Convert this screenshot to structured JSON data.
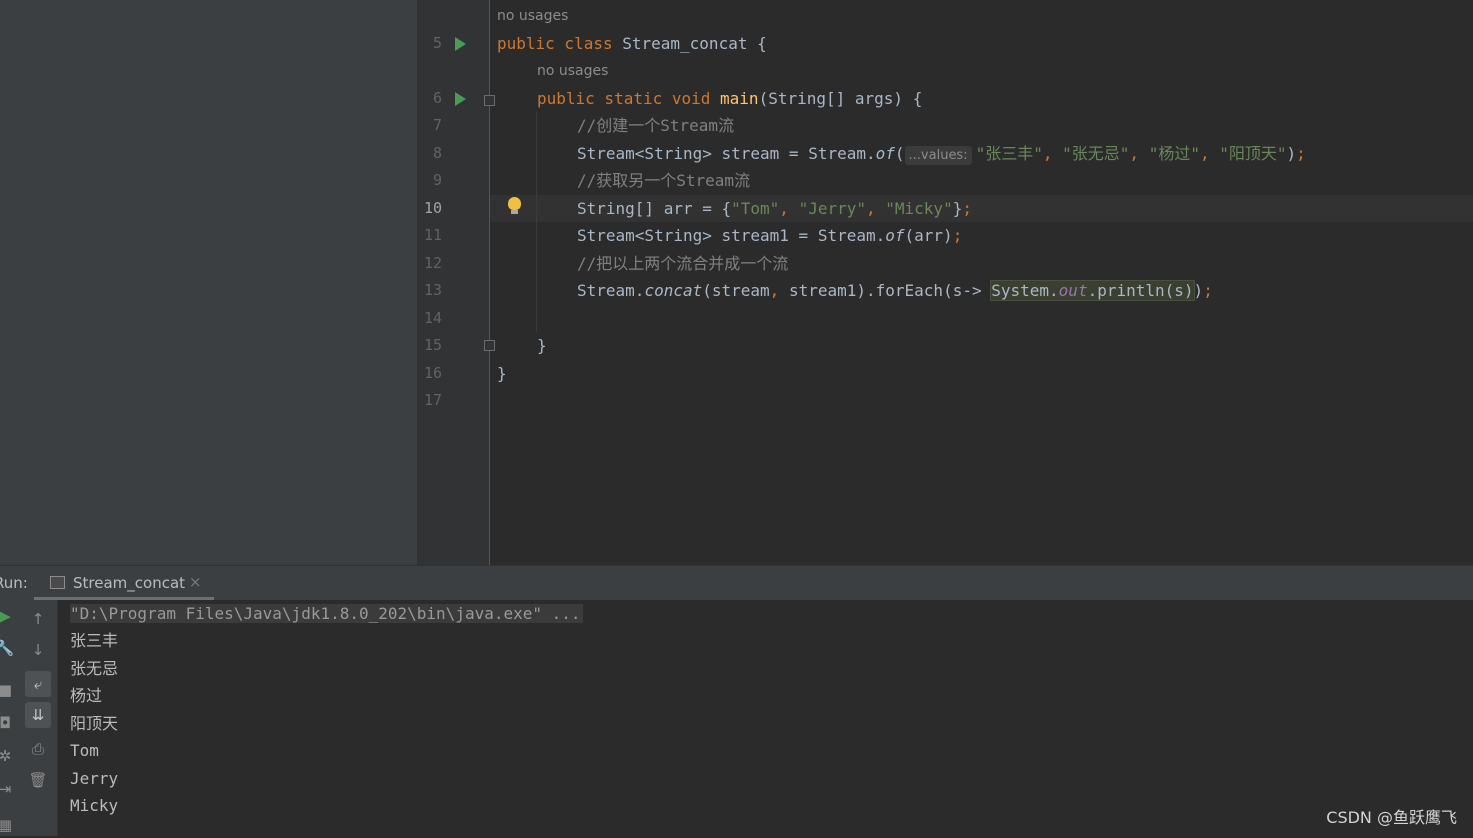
{
  "editor": {
    "hints": {
      "class_usages": "no usages",
      "main_usages": "no usages"
    },
    "line_numbers": [
      "5",
      "6",
      "7",
      "8",
      "9",
      "10",
      "11",
      "12",
      "13",
      "14",
      "15",
      "16",
      "17"
    ],
    "active_line": "10",
    "code": {
      "l5_kw": "public class ",
      "l5_name": "Stream_concat {",
      "l6_kw": "public static void ",
      "l6_fn": "main",
      "l6_rest": "(String[] args) {",
      "l7_comment": "//创建一个Stream流",
      "l8_pre": "Stream<String> stream = Stream.",
      "l8_of": "of",
      "l8_paren": "(",
      "l8_hint": "...values:",
      "l8_s1": "\"张三丰\"",
      "l8_s2": "\"张无忌\"",
      "l8_s3": "\"杨过\"",
      "l8_s4": "\"阳顶天\"",
      "l8_end": ")",
      "comma": ", ",
      "semi": ";",
      "l9_comment": "//获取另一个Stream流",
      "l10_pre": "String[] arr = {",
      "l10_s1": "\"Tom\"",
      "l10_s2": "\"Jerry\"",
      "l10_s3": "\"Micky\"",
      "l10_end": "}",
      "l11_pre": "Stream<String> stream1 = Stream.",
      "l11_of": "of",
      "l11_end": "(arr)",
      "l12_comment": "//把以上两个流合并成一个流",
      "l13_pre": "Stream.",
      "l13_concat": "concat",
      "l13_args1": "(stream",
      "l13_args2": "stream1).forEach(s-> ",
      "l13_sys": "System.",
      "l13_out": "out",
      "l13_println": ".println(s)",
      "l13_end": ")",
      "l15_brace": "}",
      "l16_brace": "}"
    }
  },
  "run_panel": {
    "label": "Run:",
    "tab_label": "Stream_concat",
    "tab_close": "×",
    "output": [
      "\"D:\\Program Files\\Java\\jdk1.8.0_202\\bin\\java.exe\" ...",
      "张三丰",
      "张无忌",
      "杨过",
      "阳顶天",
      "Tom",
      "Jerry",
      "Micky"
    ]
  },
  "toolbar": {
    "up_icon": "↑",
    "down_icon": "↓",
    "wrap_icon": "⤶",
    "scroll_end_icon": "⇊",
    "print_icon": "⎙",
    "trash_icon": "🗑",
    "rerun_icon": "▶",
    "wrench_icon": "🔧",
    "stop_icon": "■",
    "camera_icon": "◘",
    "settings_icon": "✲",
    "exit_icon": "⇥",
    "layout_icon": "▦"
  },
  "watermark": "CSDN @鱼跃鹰飞",
  "colors": {
    "keyword": "#cc7832",
    "string": "#6a8759",
    "comment": "#808080",
    "function": "#ffc66d",
    "field": "#9876aa",
    "run_green": "#499c54"
  }
}
